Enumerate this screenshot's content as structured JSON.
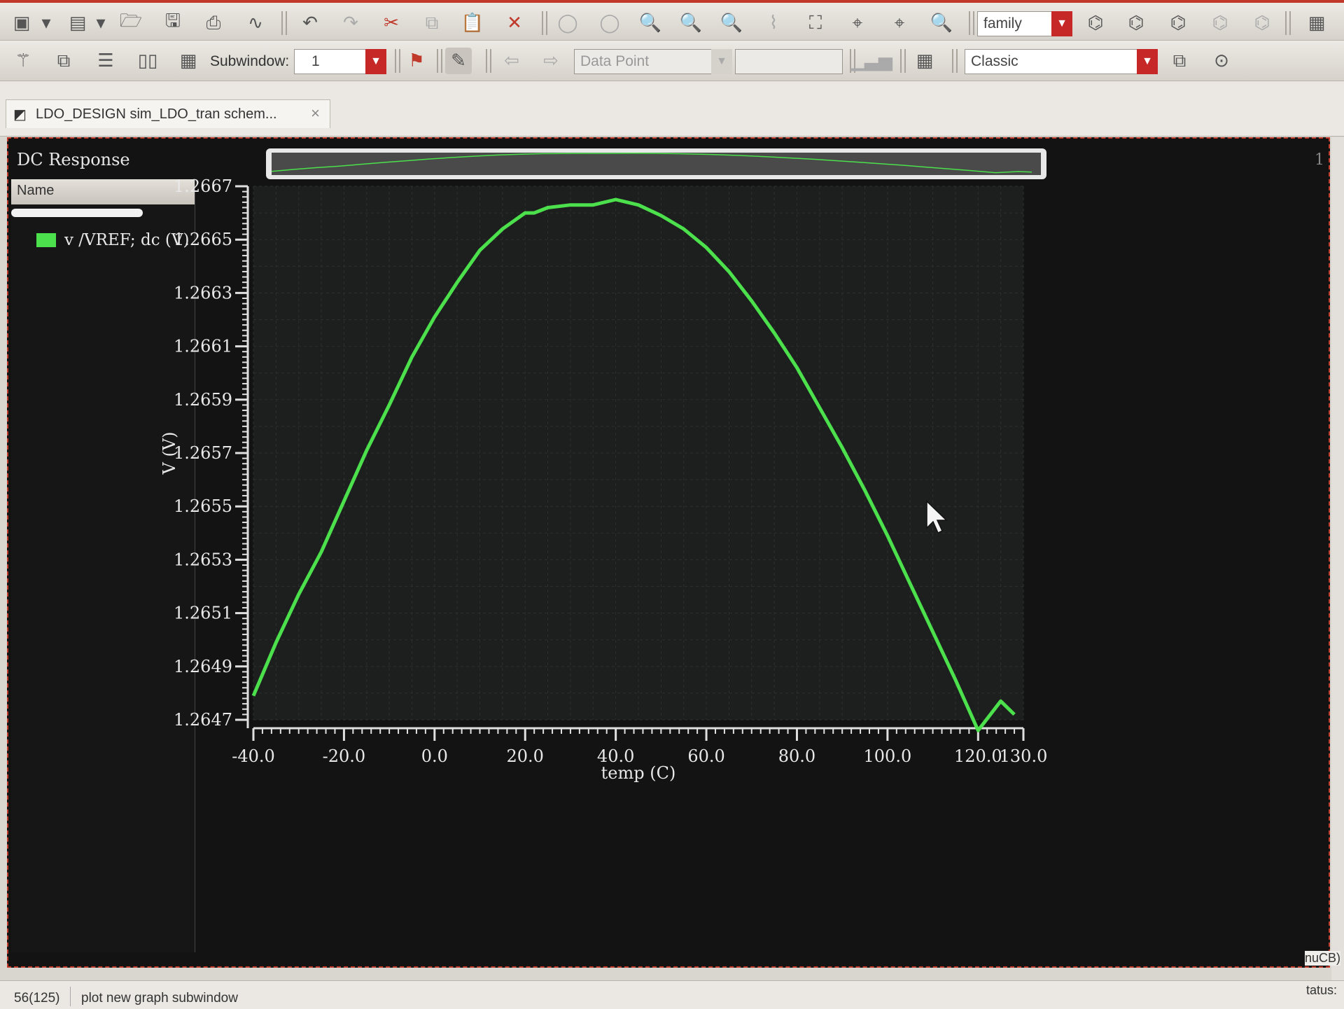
{
  "toolbar1": {
    "family_combo": "family"
  },
  "toolbar2": {
    "subwindow_label": "Subwindow:",
    "subwindow_value": "1",
    "marker_combo": "Data Point",
    "marker_value": "",
    "style_combo": "Classic"
  },
  "tab": {
    "label": "LDO_DESIGN sim_LDO_tran schem...",
    "close": "×"
  },
  "plot": {
    "title": "DC Response",
    "corner": "1",
    "legend_header": "Name",
    "legend_items": [
      {
        "label": "v /VREF; dc (V)",
        "color": "#4ce04c"
      }
    ]
  },
  "chart_data": {
    "type": "line",
    "title": "DC Response",
    "xlabel": "temp (C)",
    "ylabel": "V (V)",
    "xlim": [
      -40,
      130
    ],
    "ylim": [
      1.2647,
      1.2667
    ],
    "grid": true,
    "legend_placement": "left panel",
    "x_ticks": [
      -40.0,
      -20.0,
      0.0,
      20.0,
      40.0,
      60.0,
      80.0,
      100.0,
      120.0,
      130.0
    ],
    "x_tick_labels": [
      "-40.0",
      "-20.0",
      "0.0",
      "20.0",
      "40.0",
      "60.0",
      "80.0",
      "100.0",
      "120.0",
      "130.0"
    ],
    "y_ticks": [
      1.2647,
      1.2649,
      1.2651,
      1.2653,
      1.2655,
      1.2657,
      1.2659,
      1.2661,
      1.2663,
      1.2665,
      1.2667
    ],
    "y_tick_labels": [
      "1.2647",
      "1.2649",
      "1.2651",
      "1.2653",
      "1.2655",
      "1.2657",
      "1.2659",
      "1.2661",
      "1.2663",
      "1.2665",
      "1.2667"
    ],
    "series": [
      {
        "name": "v /VREF; dc (V)",
        "color": "#4ce04c",
        "x": [
          -40,
          -35,
          -30,
          -25,
          -20,
          -15,
          -10,
          -5,
          0,
          5,
          10,
          15,
          20,
          22,
          25,
          30,
          35,
          40,
          45,
          50,
          55,
          60,
          65,
          70,
          75,
          80,
          85,
          90,
          95,
          100,
          105,
          110,
          115,
          120,
          125,
          128
        ],
        "y": [
          1.26479,
          1.26499,
          1.26517,
          1.26533,
          1.26552,
          1.26571,
          1.26588,
          1.26606,
          1.26621,
          1.26634,
          1.26646,
          1.26654,
          1.2666,
          1.2666,
          1.26662,
          1.26663,
          1.26663,
          1.26665,
          1.26663,
          1.26659,
          1.26654,
          1.26647,
          1.26638,
          1.26627,
          1.26615,
          1.26602,
          1.26587,
          1.26572,
          1.26556,
          1.26539,
          1.26521,
          1.26503,
          1.26485,
          1.26466,
          1.26477,
          1.26472
        ]
      }
    ]
  },
  "status": {
    "left": "56(125)",
    "message": "plot new graph subwindow",
    "edge1": "nuCB)",
    "edge2": "tatus:"
  }
}
